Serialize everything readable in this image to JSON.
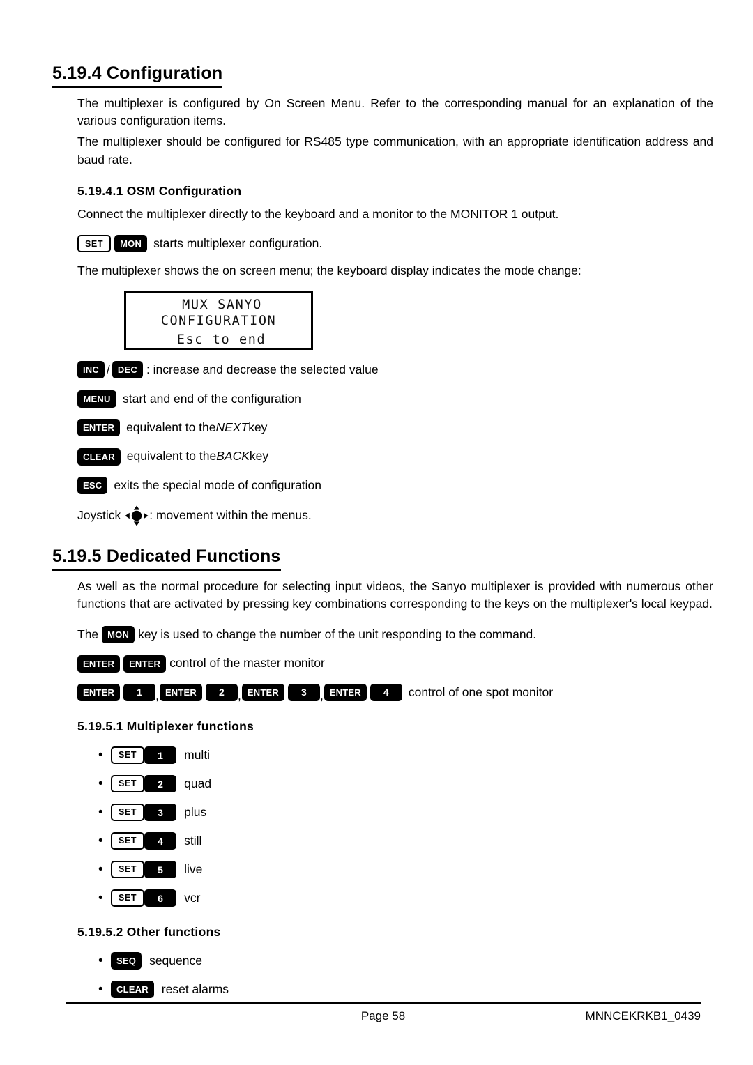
{
  "document": {
    "section_configuration": {
      "heading": "5.19.4 Configuration",
      "paragraph1": "The multiplexer is configured by On Screen Menu. Refer to the corresponding manual for an explanation of the various configuration items.",
      "paragraph2": "The multiplexer should be configured for RS485 type communication, with an appropriate identification address and baud rate.",
      "subsection_osm": {
        "heading": "5.19.4.1 OSM Configuration",
        "intro": "Connect the multiplexer directly to the keyboard and a monitor to the MONITOR 1 output.",
        "start_combo": {
          "key1": "SET",
          "key2": "MON",
          "text": "starts multiplexer configuration."
        },
        "display_intro": "The multiplexer shows the on screen menu; the keyboard display indicates the mode change:",
        "lcd_display": {
          "line1": "MUX SANYO",
          "line2": "CONFIGURATION",
          "line3": "Esc to end"
        },
        "key_legend": [
          {
            "keys": [
              "INC",
              "DEC"
            ],
            "separator": "/",
            "description": ": increase and decrease the selected value"
          },
          {
            "keys": [
              "MENU"
            ],
            "description": "start and end of the configuration"
          },
          {
            "keys": [
              "ENTER"
            ],
            "description_pre": "equivalent to the ",
            "description_em": "NEXT",
            "description_post": " key"
          },
          {
            "keys": [
              "CLEAR"
            ],
            "description_pre": "equivalent to the ",
            "description_em": "BACK",
            "description_post": " key"
          },
          {
            "keys": [
              "ESC"
            ],
            "description": "exits the special mode of configuration"
          }
        ],
        "joystick": {
          "label": "Joystick",
          "icon": "joystick-4way-icon",
          "description": ": movement within the menus."
        }
      }
    },
    "section_dedicated": {
      "heading": "5.19.5 Dedicated Functions",
      "paragraph1": "As well as the normal procedure for selecting input videos, the Sanyo multiplexer is provided with numerous other functions that are activated by pressing key combinations corresponding to the keys on the multiplexer's local keypad.",
      "mon_line": {
        "pre": "The",
        "key": "MON",
        "post": "key is used to change the number of the unit responding to the command."
      },
      "master_monitor": {
        "key1": "ENTER",
        "key2": "ENTER",
        "text": "control of the master monitor"
      },
      "spot_monitor": {
        "pairs": [
          {
            "enter": "ENTER",
            "num": "1",
            "comma": ","
          },
          {
            "enter": "ENTER",
            "num": "2",
            "comma": ","
          },
          {
            "enter": "ENTER",
            "num": "3",
            "comma": ","
          },
          {
            "enter": "ENTER",
            "num": "4",
            "comma": ""
          }
        ],
        "text": "control of one spot monitor"
      },
      "subsection_multiplexer": {
        "heading": "5.19.5.1 Multiplexer functions",
        "items": [
          {
            "bullet": "•",
            "key1": "SET",
            "key2": "1",
            "label": "multi"
          },
          {
            "bullet": "•",
            "key1": "SET",
            "key2": "2",
            "label": "quad"
          },
          {
            "bullet": "•",
            "key1": "SET",
            "key2": "3",
            "label": "plus"
          },
          {
            "bullet": "•",
            "key1": "SET",
            "key2": "4",
            "label": "still"
          },
          {
            "bullet": "•",
            "key1": "SET",
            "key2": "5",
            "label": "live"
          },
          {
            "bullet": "•",
            "key1": "SET",
            "key2": "6",
            "label": "vcr"
          }
        ]
      },
      "subsection_other": {
        "heading": "5.19.5.2 Other functions",
        "items": [
          {
            "bullet": "•",
            "key1": "SEQ",
            "label": "sequence"
          },
          {
            "bullet": "•",
            "key1": "CLEAR",
            "label": "reset alarms"
          }
        ]
      }
    },
    "footer": {
      "page": "Page 58",
      "doc_code": "MNNCEKRKB1_0439"
    }
  }
}
